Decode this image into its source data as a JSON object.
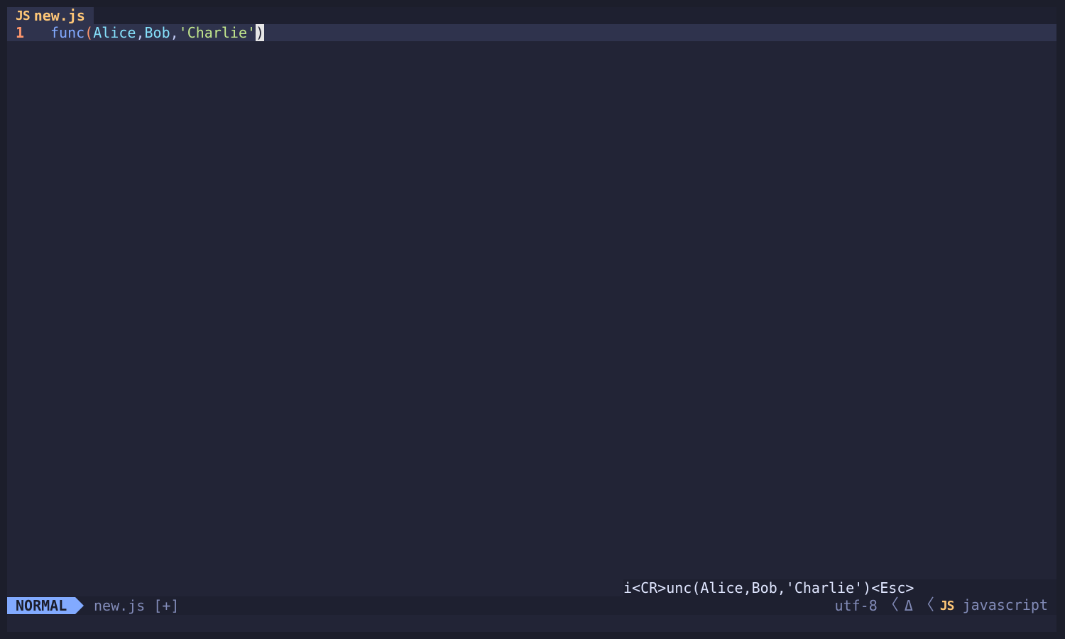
{
  "tabline": {
    "tab_icon": "JS",
    "tab_name": "new.js"
  },
  "editor": {
    "line_number": "1",
    "code_tokens": {
      "fn": "func",
      "open_paren": "(",
      "arg1": "Alice",
      "comma1": ",",
      "arg2": "Bob",
      "comma2": ",",
      "arg3": "'Charlie'",
      "close_paren": ")"
    }
  },
  "showcmd": "i<CR>unc(Alice,Bob,'Charlie')<Esc>",
  "statusline": {
    "mode": "NORMAL",
    "file": "new.js [+]",
    "encoding": "utf-8",
    "separator": "〈",
    "delta_icon": "Δ",
    "filetype_icon": "JS",
    "filetype": "javascript"
  },
  "colors": {
    "background": "#222436",
    "mode_bg": "#82aaff",
    "line_number": "#ff966c",
    "string": "#c3e88d",
    "identifier": "#86e1fc",
    "function": "#82aaff",
    "js_icon": "#ffc777"
  }
}
